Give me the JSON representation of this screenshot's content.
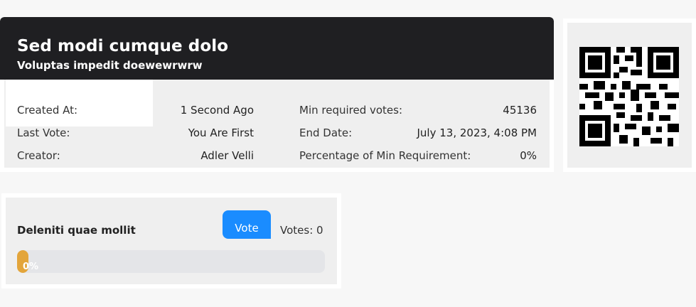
{
  "poll": {
    "title": "Sed modi cumque dolo",
    "subtitle": "Voluptas impedit doewewrwrw",
    "details": [
      {
        "label": "Created At:",
        "value": "1 Second Ago"
      },
      {
        "label": "Last Vote:",
        "value": "You Are First"
      },
      {
        "label": "Creator:",
        "value": "Adler Velli"
      }
    ],
    "details_right": [
      {
        "label": "Min required votes:",
        "value": "45136"
      },
      {
        "label": "End Date:",
        "value": "July 13, 2023, 4:08 PM"
      },
      {
        "label": "Percentage of Min Requirement:",
        "value": "0%"
      }
    ]
  },
  "qr": {
    "icon": "qr-code-icon"
  },
  "options": [
    {
      "label": "Deleniti quae mollit",
      "vote_button": "Vote",
      "votes_text": "Votes: 0",
      "progress_text": "0%",
      "progress_fraction": 0
    }
  ],
  "colors": {
    "header_bg": "#1f1f22",
    "vote_button": "#1a8cff",
    "progress_fill": "#e3a53b",
    "progress_track": "#e4e5e8"
  }
}
